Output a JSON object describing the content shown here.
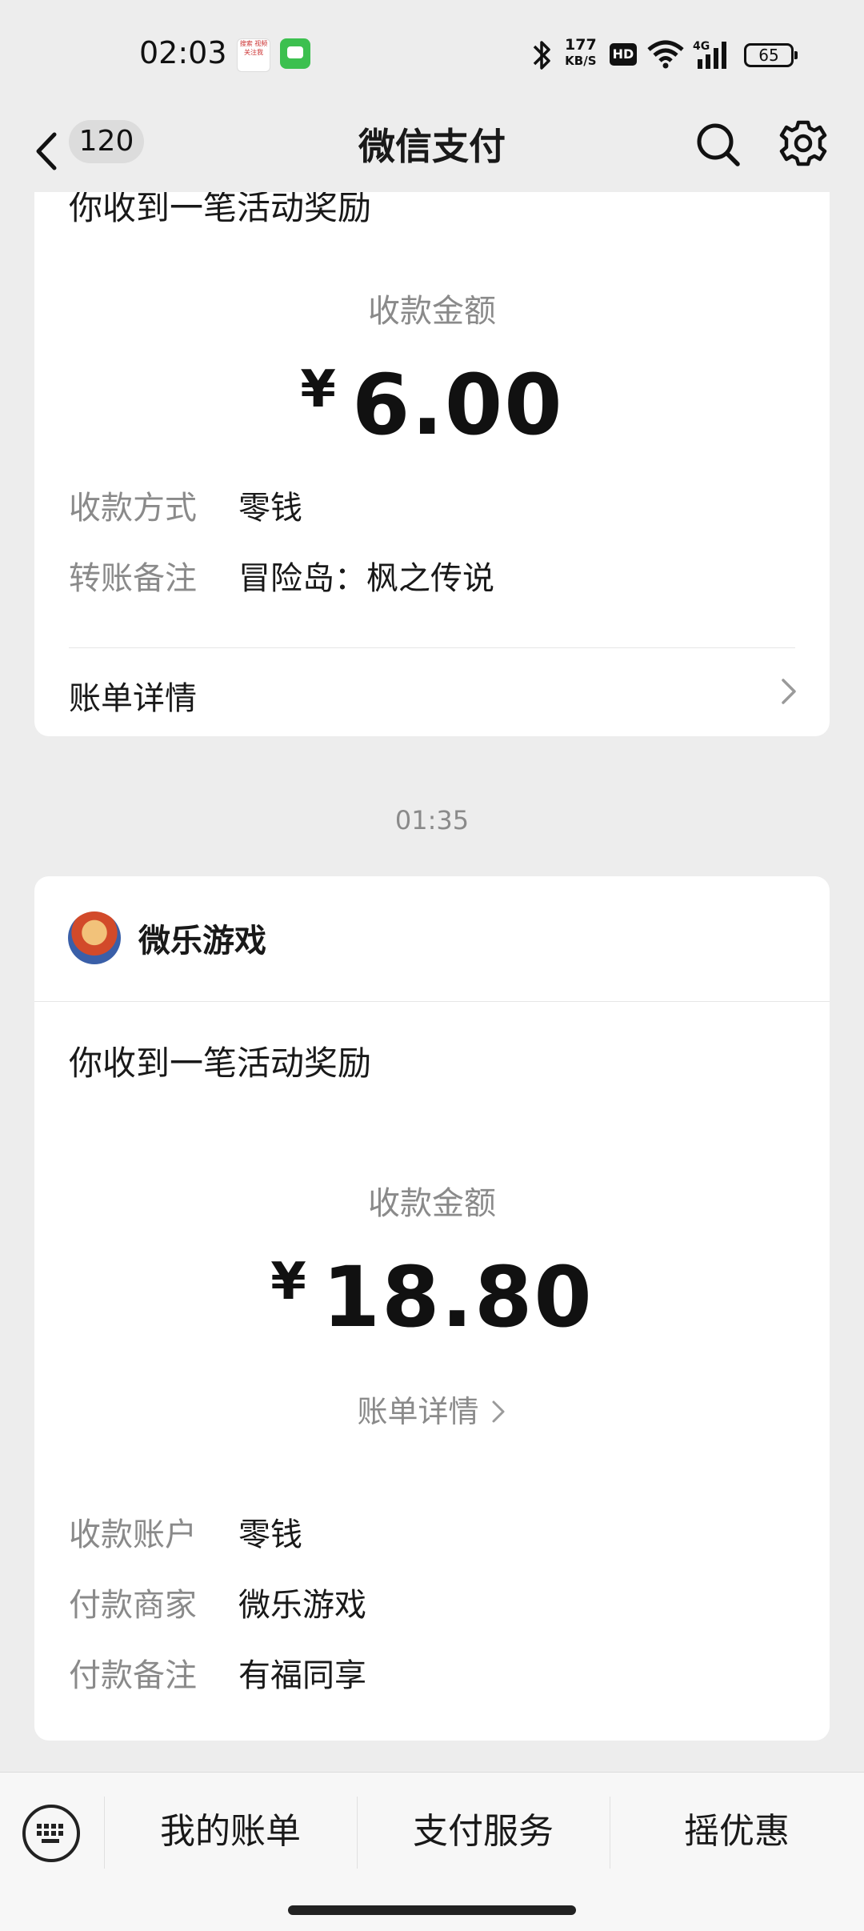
{
  "status_bar": {
    "time": "02:03",
    "net_speed_value": "177",
    "net_speed_unit": "KB/S",
    "hd": "HD",
    "signal_label": "4G",
    "battery": "65",
    "notif_app_text": "搜索 视频 关注我"
  },
  "nav": {
    "unread_count": "120",
    "title": "微信支付"
  },
  "card1": {
    "title": "你收到一笔活动奖励",
    "amount_label": "收款金额",
    "currency": "¥",
    "amount": "6.00",
    "rows": [
      {
        "label": "收款方式",
        "value": "零钱"
      },
      {
        "label": "转账备注",
        "value": "冒险岛：枫之传说"
      }
    ],
    "bill_detail": "账单详情"
  },
  "timestamp": "01:35",
  "card2": {
    "merchant": "微乐游戏",
    "title": "你收到一笔活动奖励",
    "amount_label": "收款金额",
    "currency": "¥",
    "amount": "18.80",
    "bill_detail": "账单详情",
    "rows": [
      {
        "label": "收款账户",
        "value": "零钱"
      },
      {
        "label": "付款商家",
        "value": "微乐游戏"
      },
      {
        "label": "付款备注",
        "value": "有福同享"
      }
    ]
  },
  "bottom_menu": {
    "items": [
      "我的账单",
      "支付服务",
      "摇优惠"
    ]
  }
}
